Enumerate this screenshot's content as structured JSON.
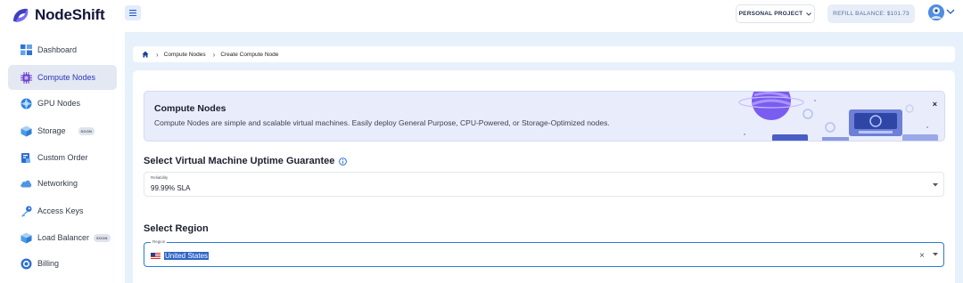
{
  "brand": {
    "name": "NodeShift"
  },
  "header": {
    "project_label": "PERSONAL PROJECT",
    "refill_label": "REFILL BALANCE: $101.73"
  },
  "sidebar": {
    "items": [
      {
        "label": "Dashboard",
        "icon": "dashboard-icon"
      },
      {
        "label": "Compute Nodes",
        "icon": "chip-icon",
        "active": true
      },
      {
        "label": "GPU Nodes",
        "icon": "gpu-icon"
      },
      {
        "label": "Storage",
        "icon": "storage-icon",
        "badge": "SOON"
      },
      {
        "label": "Custom Order",
        "icon": "custom-order-icon"
      },
      {
        "label": "Networking",
        "icon": "cloud-icon"
      },
      {
        "label": "Access Keys",
        "icon": "key-icon"
      },
      {
        "label": "Load Balancer",
        "icon": "load-balancer-icon",
        "badge": "SOON"
      },
      {
        "label": "Billing",
        "icon": "billing-icon"
      }
    ]
  },
  "breadcrumb": {
    "items": [
      "Compute Nodes",
      "Create Compute Node"
    ]
  },
  "banner": {
    "title": "Compute Nodes",
    "description": "Compute Nodes are simple and scalable virtual machines. Easily deploy General Purpose, CPU-Powered, or Storage-Optimized nodes.",
    "close": "×"
  },
  "uptime": {
    "title": "Select Virtual Machine Uptime Guarantee",
    "field_label": "Reliability",
    "value": "99.99% SLA"
  },
  "region": {
    "title": "Select Region",
    "field_label": "Region",
    "value": "United States",
    "clear": "×"
  },
  "colors": {
    "accent": "#2b35b8",
    "focus": "#2a7bd4",
    "main_bg": "#e7f1fb"
  }
}
